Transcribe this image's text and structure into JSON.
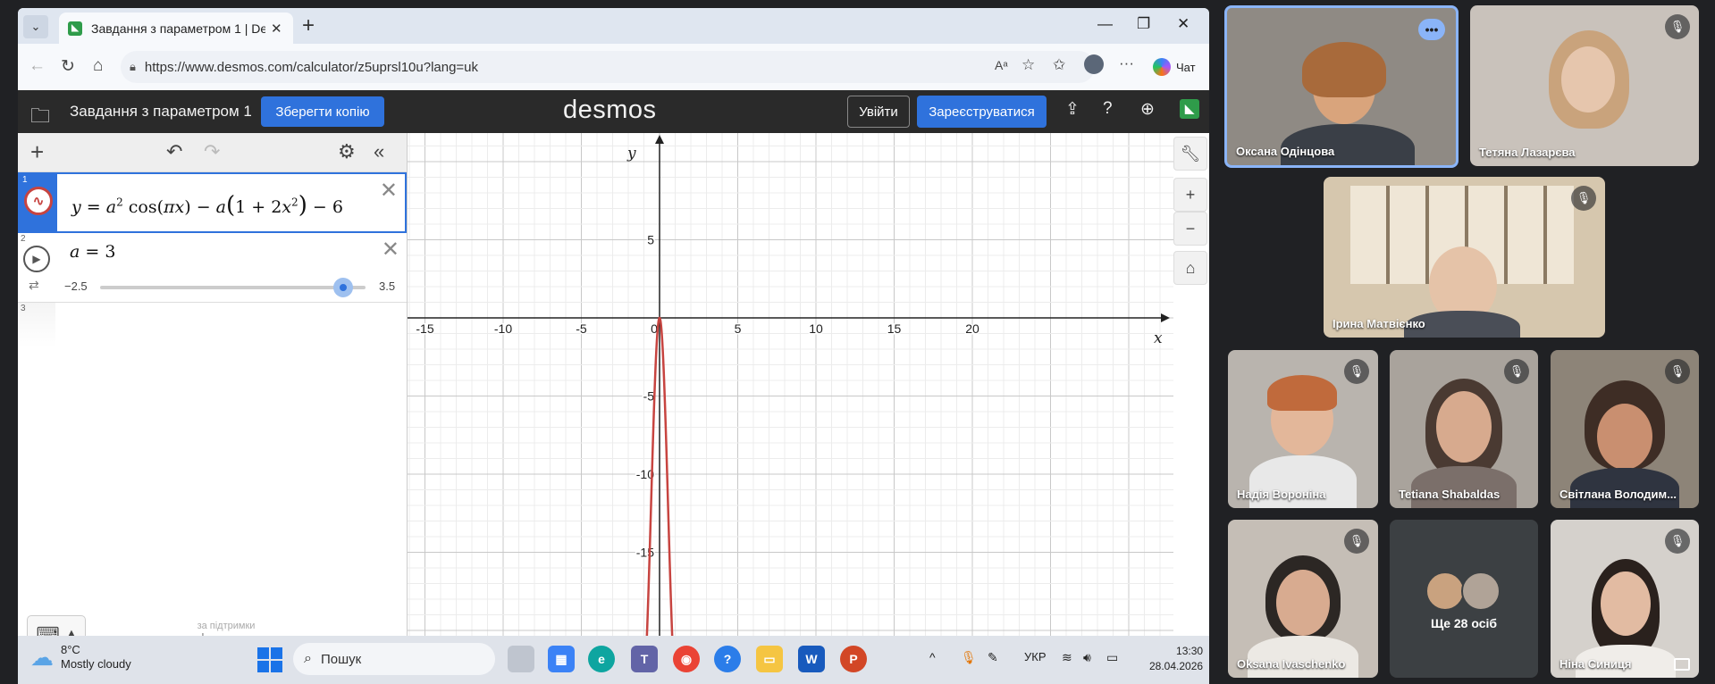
{
  "browser": {
    "tab_title": "Завдання з параметром 1 | Desmos",
    "url": "https://www.desmos.com/calculator/z5uprsl10u?lang=uk",
    "copilot_label": "Чат"
  },
  "desmos": {
    "graph_title": "Завдання з параметром 1",
    "save_button": "Зберегти копію",
    "logo": "desmos",
    "login_button": "Увійти",
    "signup_button": "Зареєструватися",
    "expressions": [
      {
        "index": "1",
        "color": "#c74440"
      },
      {
        "index": "2",
        "slider_min": "−2.5",
        "slider_max": "3.5",
        "slider_value": 3
      },
      {
        "index": "3"
      }
    ],
    "powered_by_top": "за підтримки",
    "powered_by_logo": "desmos"
  },
  "graph": {
    "x_axis_label": "x",
    "y_axis_label": "y",
    "x_ticks": [
      "-15",
      "-10",
      "-5",
      "0",
      "5",
      "10",
      "15",
      "20"
    ],
    "y_ticks": [
      "5",
      "-5",
      "-10",
      "-15"
    ],
    "curve_color": "#c74440"
  },
  "taskbar": {
    "temperature": "8°C",
    "weather": "Mostly cloudy",
    "search_placeholder": "Пошук",
    "language": "УКР",
    "time": "13:30",
    "date": "28.04.2026"
  },
  "meeting": {
    "participants": [
      {
        "name": "Оксана Одінцова"
      },
      {
        "name": "Тетяна Лазарєва"
      },
      {
        "name": "Ірина Матвієнко"
      },
      {
        "name": "Надія Вороніна"
      },
      {
        "name": "Tetiana Shabaldas"
      },
      {
        "name": "Світлана Володим..."
      },
      {
        "name": "Oksana Ivaschenko"
      },
      {
        "name": "Ще 28 осіб"
      },
      {
        "name": "Ніна Синиця"
      }
    ]
  }
}
